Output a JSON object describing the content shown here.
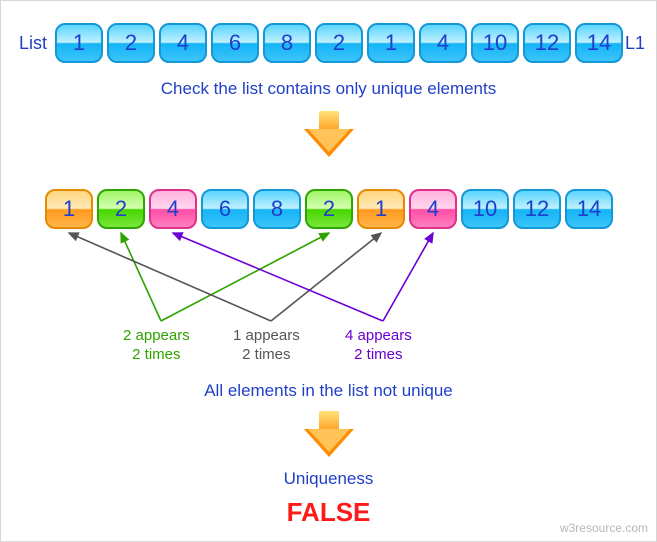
{
  "labels": {
    "list_left": "List",
    "list_right": "L1",
    "caption_check": "Check the list contains only unique elements",
    "caption_notunique": "All elements in the list not unique",
    "uniqueness": "Uniqueness",
    "result": "FALSE",
    "watermark": "w3resource.com"
  },
  "row1": [
    "1",
    "2",
    "4",
    "6",
    "8",
    "2",
    "1",
    "4",
    "10",
    "12",
    "14"
  ],
  "row2": [
    {
      "v": "1",
      "c": "orange"
    },
    {
      "v": "2",
      "c": "green"
    },
    {
      "v": "4",
      "c": "pink"
    },
    {
      "v": "6",
      "c": "blue"
    },
    {
      "v": "8",
      "c": "blue"
    },
    {
      "v": "2",
      "c": "green"
    },
    {
      "v": "1",
      "c": "orange"
    },
    {
      "v": "4",
      "c": "pink"
    },
    {
      "v": "10",
      "c": "blue"
    },
    {
      "v": "12",
      "c": "blue"
    },
    {
      "v": "14",
      "c": "blue"
    }
  ],
  "notes": {
    "green": "2 appears\n2 times",
    "gray": "1 appears\n2 times",
    "purple": "4 appears\n2 times"
  },
  "chart_data": {
    "type": "table",
    "title": "Check the list contains only unique elements",
    "list_name": "L1",
    "list": [
      1,
      2,
      4,
      6,
      8,
      2,
      1,
      4,
      10,
      12,
      14
    ],
    "duplicate_groups": [
      {
        "value": 1,
        "count": 2,
        "indices": [
          0,
          6
        ],
        "highlight": "orange"
      },
      {
        "value": 2,
        "count": 2,
        "indices": [
          1,
          5
        ],
        "highlight": "green"
      },
      {
        "value": 4,
        "count": 2,
        "indices": [
          2,
          7
        ],
        "highlight": "pink"
      }
    ],
    "all_unique": false,
    "result_label": "FALSE"
  }
}
